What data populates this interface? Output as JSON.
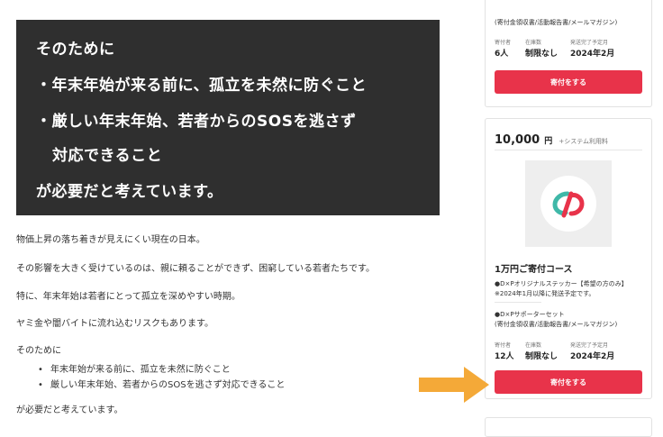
{
  "hero": {
    "line1": "そのために",
    "line2": "・年末年始が来る前に、孤立を未然に防ぐこと",
    "line3": "・厳しい年末年始、若者からのSOSを逃さず",
    "line4": "対応できること",
    "line5": "が必要だと考えています。"
  },
  "body": {
    "p1": "物価上昇の落ち着きが見えにくい現在の日本。",
    "p2": "その影響を大きく受けているのは、親に頼ることができず、困窮している若者たちです。",
    "p3": "特に、年末年始は若者にとって孤立を深めやすい時期。",
    "p4": "ヤミ金や闇バイトに流れ込むリスクもあります。",
    "p5": "そのために",
    "bullets": [
      "年末年始が来る前に、孤立を未然に防ぐこと",
      "厳しい年末年始、若者からのSOSを逃さず対応できること"
    ],
    "p6": "が必要だと考えています。"
  },
  "card_top": {
    "desc": "(寄付金領収書/活動報告書/メールマガジン)",
    "donor_label": "寄付者",
    "donor_value": "6人",
    "stock_label": "在庫数",
    "stock_value": "制限なし",
    "ship_label": "発送完了予定月",
    "ship_value": "2024年2月",
    "button": "寄付をする"
  },
  "card_main": {
    "price": "10,000",
    "unit": "円",
    "system_fee": "+システム利用料",
    "course": "1万円ご寄付コース",
    "item1": "●D×Pオリジナルステッカー【希望の方のみ】",
    "item1_note": "※2024年1月以降に発送予定です。",
    "item2": "●D×Pサポーターセット",
    "item2_note": "(寄付金領収書/活動報告書/メールマガジン)",
    "donor_label": "寄付者",
    "donor_value": "12人",
    "stock_label": "在庫数",
    "stock_value": "制限なし",
    "ship_label": "発送完了予定月",
    "ship_value": "2024年2月",
    "button": "寄付をする"
  },
  "colors": {
    "accent": "#e8334a",
    "arrow": "#f4a938",
    "hero_bg": "#2f2f2f",
    "logo_teal": "#3fb8a8",
    "logo_red": "#e8334a"
  },
  "icons": {
    "logo": "dxp-logo-icon",
    "arrow": "arrow-right-icon"
  }
}
